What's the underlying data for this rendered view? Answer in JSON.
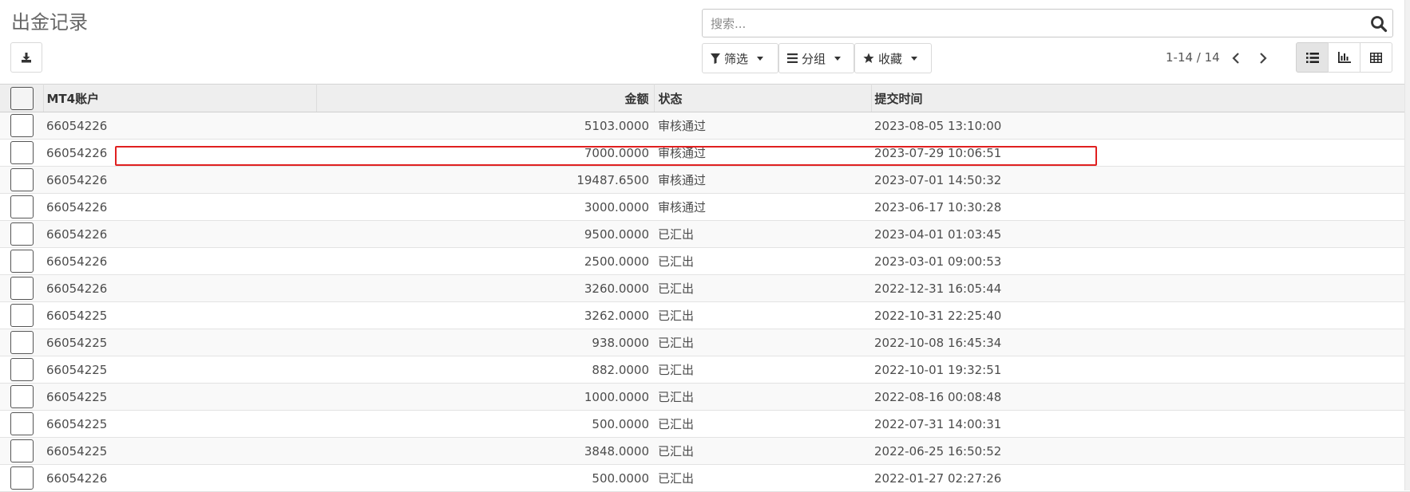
{
  "page": {
    "title": "出金记录"
  },
  "toolbar": {
    "download_icon": "download-icon"
  },
  "search": {
    "placeholder": "搜索...",
    "value": ""
  },
  "filters": [
    {
      "label": "筛选",
      "icon": "filter-icon"
    },
    {
      "label": "分组",
      "icon": "list-bars-icon"
    },
    {
      "label": "收藏",
      "icon": "star-icon"
    }
  ],
  "pager": {
    "text": "1-14 / 14"
  },
  "views": [
    {
      "name": "list-view",
      "active": true
    },
    {
      "name": "graph-view",
      "active": false
    },
    {
      "name": "pivot-view",
      "active": false
    }
  ],
  "table": {
    "headers": {
      "account": "MT4账户",
      "amount": "金额",
      "status": "状态",
      "time": "提交时间"
    },
    "rows": [
      {
        "account": "66054226",
        "amount": "5103.0000",
        "status": "审核通过",
        "time": "2023-08-05 13:10:00"
      },
      {
        "account": "66054226",
        "amount": "7000.0000",
        "status": "审核通过",
        "time": "2023-07-29 10:06:51"
      },
      {
        "account": "66054226",
        "amount": "19487.6500",
        "status": "审核通过",
        "time": "2023-07-01 14:50:32"
      },
      {
        "account": "66054226",
        "amount": "3000.0000",
        "status": "审核通过",
        "time": "2023-06-17 10:30:28"
      },
      {
        "account": "66054226",
        "amount": "9500.0000",
        "status": "已汇出",
        "time": "2023-04-01 01:03:45"
      },
      {
        "account": "66054226",
        "amount": "2500.0000",
        "status": "已汇出",
        "time": "2023-03-01 09:00:53"
      },
      {
        "account": "66054226",
        "amount": "3260.0000",
        "status": "已汇出",
        "time": "2022-12-31 16:05:44"
      },
      {
        "account": "66054225",
        "amount": "3262.0000",
        "status": "已汇出",
        "time": "2022-10-31 22:25:40"
      },
      {
        "account": "66054225",
        "amount": "938.0000",
        "status": "已汇出",
        "time": "2022-10-08 16:45:34"
      },
      {
        "account": "66054225",
        "amount": "882.0000",
        "status": "已汇出",
        "time": "2022-10-01 19:32:51"
      },
      {
        "account": "66054225",
        "amount": "1000.0000",
        "status": "已汇出",
        "time": "2022-08-16 00:08:48"
      },
      {
        "account": "66054225",
        "amount": "500.0000",
        "status": "已汇出",
        "time": "2022-07-31 14:00:31"
      },
      {
        "account": "66054225",
        "amount": "3848.0000",
        "status": "已汇出",
        "time": "2022-06-25 16:50:52"
      },
      {
        "account": "66054226",
        "amount": "500.0000",
        "status": "已汇出",
        "time": "2022-01-27 02:27:26"
      }
    ]
  },
  "colors": {
    "highlight": "#e02020",
    "header_bg": "#eeeeee"
  }
}
